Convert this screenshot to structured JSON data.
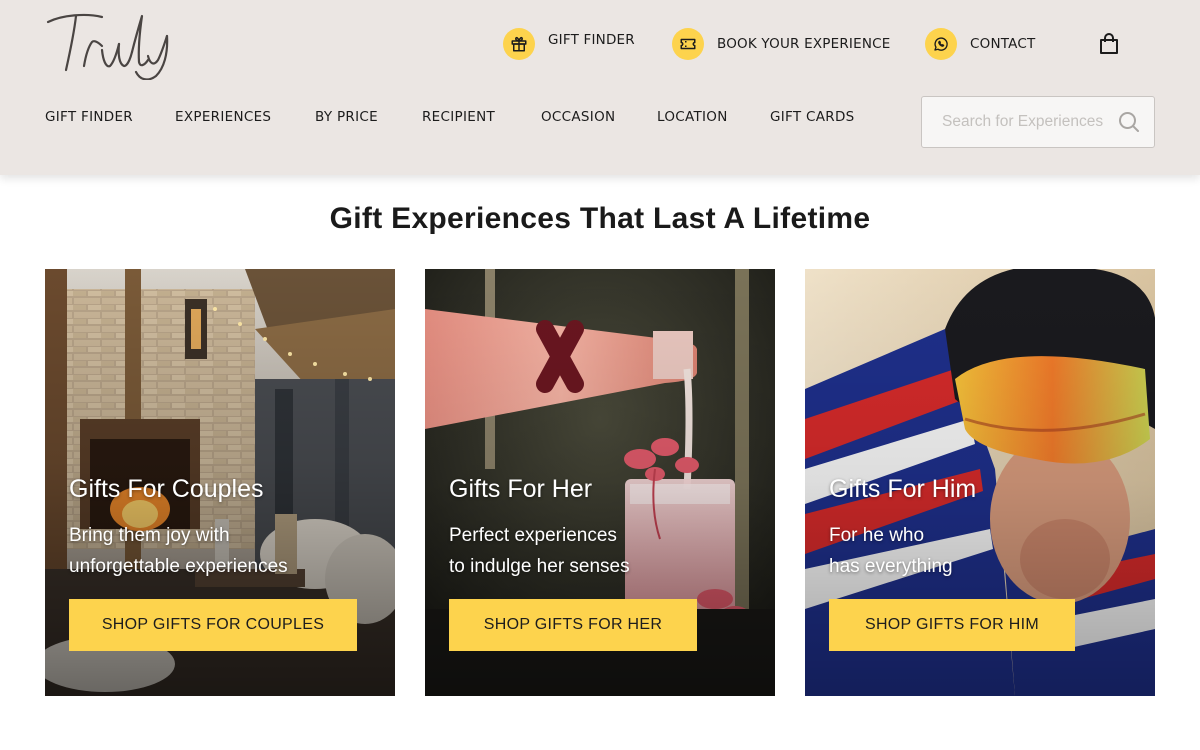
{
  "brand": {
    "logo_text": "Truly"
  },
  "utility_nav": {
    "gift_finder": "GIFT FINDER",
    "book_experience": "BOOK YOUR EXPERIENCE",
    "contact": "CONTACT"
  },
  "main_nav": {
    "items": [
      {
        "label": "GIFT FINDER"
      },
      {
        "label": "EXPERIENCES"
      },
      {
        "label": "BY PRICE"
      },
      {
        "label": "RECIPIENT"
      },
      {
        "label": "OCCASION"
      },
      {
        "label": "LOCATION"
      },
      {
        "label": "GIFT CARDS"
      }
    ]
  },
  "search": {
    "placeholder": "Search for Experiences",
    "value": ""
  },
  "page": {
    "title": "Gift Experiences That Last A Lifetime"
  },
  "cards": [
    {
      "title": "Gifts For Couples",
      "subtitle_line1": "Bring them joy with",
      "subtitle_line2": "unforgettable experiences",
      "cta": "SHOP GIFTS FOR COUPLES",
      "image": "outdoor-terrace-fireplace"
    },
    {
      "title": "Gifts For Her",
      "subtitle_line1": "Perfect experiences",
      "subtitle_line2": "to indulge her senses",
      "cta": "SHOP GIFTS FOR HER",
      "image": "pink-drink-pour"
    },
    {
      "title": "Gifts For Him",
      "subtitle_line1": "For he who",
      "subtitle_line2": "has everything",
      "cta": "SHOP GIFTS FOR HIM",
      "image": "track-cyclist-helmet"
    }
  ],
  "icons": {
    "gift_finder": "gift-icon",
    "book": "ticket-icon",
    "contact": "whatsapp-icon",
    "cart": "shopping-bag-icon",
    "search": "search-icon"
  },
  "colors": {
    "header_bg": "#ebe6e3",
    "accent_yellow": "#fdd34d",
    "text_dark": "#1c1c1c",
    "logo": "#4a4543"
  }
}
